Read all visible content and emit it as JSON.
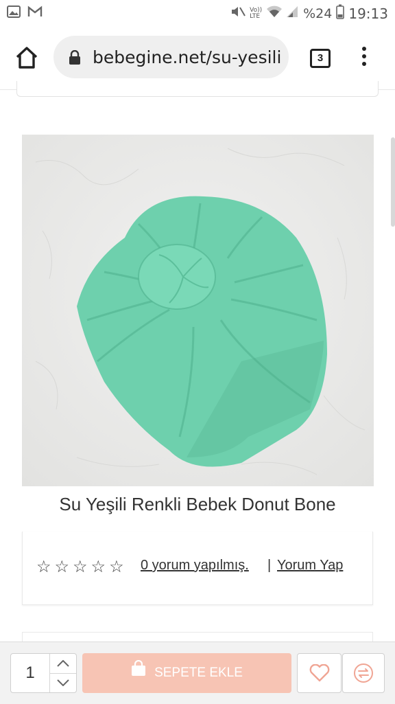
{
  "status_bar": {
    "battery": "%24",
    "time": "19:13",
    "volte_label": "Vo))",
    "lte_label": "LTE"
  },
  "browser": {
    "url": "bebegine.net/su-yesili",
    "tab_count": "3"
  },
  "product": {
    "title": "Su Yeşili Renkli Bebek Donut Bone",
    "image_color": "#6ed0ad",
    "rating_stars": 0
  },
  "reviews": {
    "count_link": "0 yorum yapılmış.",
    "separator": "|",
    "write_link": "Yorum Yap"
  },
  "cart": {
    "quantity": "1",
    "add_to_cart_label": "SEPETE EKLE",
    "accent_color": "#f7c4b4",
    "icon_color": "#f0a594"
  },
  "icons": [
    "gallery-icon",
    "gmail-icon",
    "mute-icon",
    "wifi-icon",
    "signal-icon",
    "battery-icon",
    "home-icon",
    "lock-icon",
    "menu-icon",
    "star-icon",
    "bag-icon",
    "heart-icon",
    "compare-icon"
  ]
}
